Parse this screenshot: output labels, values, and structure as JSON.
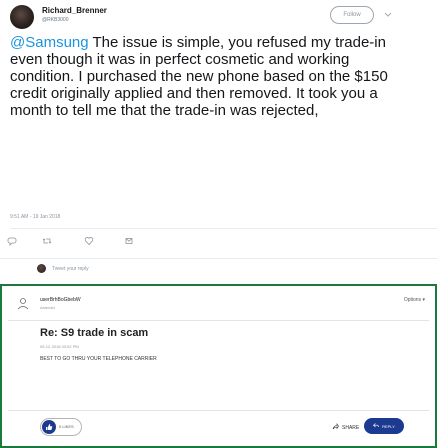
{
  "tweet": {
    "author_name": "Richard_Brenner",
    "author_handle": "@RKB3000",
    "follow_label": "Follow",
    "mention": "@Samsung",
    "text": " The issue is simple, you refused my trade-in even though it was in perfect cosmetic and working condition.  I purchased the new phone based on the $150 credit  originally applied and then removed. It took you a month to tell me that the trade-in was rejected,",
    "timestamp": "9:51 AM - 19 Jan 2018",
    "reply_placeholder": "Tweet your reply",
    "colors": {
      "mention": "#1b95e0",
      "text": "#14171a",
      "meta": "#8a96a0"
    },
    "icons": [
      "reply-icon",
      "retweet-icon",
      "like-icon",
      "direct-message-icon"
    ]
  },
  "forum": {
    "username": "userBrhBoGbebW",
    "role": "Asteroid",
    "options_label": "Options ▾",
    "title": "Re: S9 trade in scam",
    "date": "05-12-2018 03:52 PM",
    "body": "BEST TO GO THRU YOUR TELEPHONE CARRIER",
    "likes_label": "0 LIKES",
    "share_label": "SHARE",
    "reply_label": "REPLY",
    "colors": {
      "border": "#1a7a3c",
      "brand": "#1d3a91"
    }
  }
}
